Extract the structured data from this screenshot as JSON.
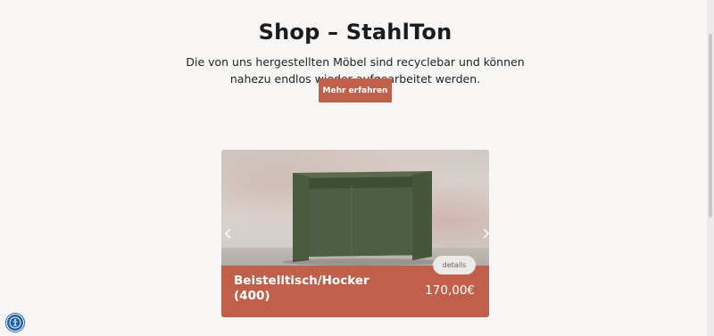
{
  "hero": {
    "title": "Shop – StahlTon",
    "intro_line1": "Die von uns hergestellten Möbel sind recyclebar und können",
    "intro_line2": "nahezu endlos wieder aufgearbeitet werden.",
    "cta_label": "Mehr erfahren"
  },
  "product": {
    "name": "Beistelltisch/Hocker (400)",
    "price": "170,00€",
    "details_label": "details",
    "carousel_position": 1
  },
  "icons": {
    "prev": "chevron-left-icon",
    "next": "chevron-right-icon",
    "accessibility": "accessibility-icon"
  },
  "colors": {
    "accent": "#c0604a",
    "background": "#f7f6f4",
    "product_color": "#4a5a3e",
    "accessibility": "#1c5fa8"
  }
}
